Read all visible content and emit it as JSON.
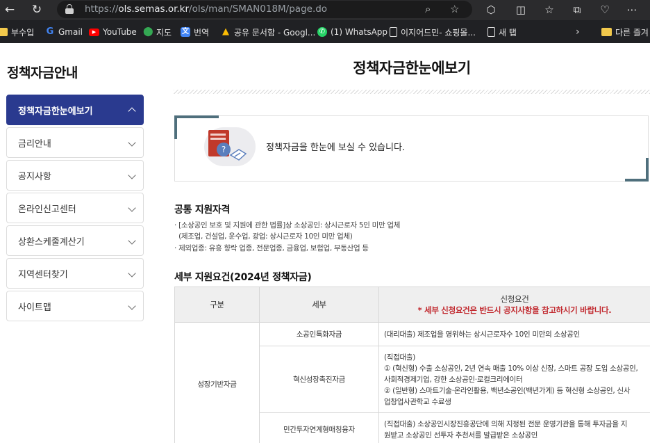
{
  "browser": {
    "url_prefix": "https://",
    "url_host": "ols.semas.or.kr",
    "url_path": "/ols/man/SMAN018M/page.do",
    "bookmarks": [
      {
        "label": "부수입",
        "icon": "folder-icon"
      },
      {
        "label": "Gmail",
        "icon": "google-icon"
      },
      {
        "label": "YouTube",
        "icon": "youtube-icon"
      },
      {
        "label": "지도",
        "icon": "maps-icon"
      },
      {
        "label": "번역",
        "icon": "translate-icon"
      },
      {
        "label": "공유 문서함 - Googl...",
        "icon": "drive-icon"
      },
      {
        "label": "(1) WhatsApp",
        "icon": "whatsapp-icon"
      },
      {
        "label": "이지어드민- 쇼핑몰...",
        "icon": "page-icon"
      },
      {
        "label": "새 탭",
        "icon": "page-icon"
      },
      {
        "label": "다른 즐겨",
        "icon": "folder-icon"
      }
    ]
  },
  "sidebar": {
    "title": "정책자금안내",
    "items": [
      {
        "label": "정책자금한눈에보기",
        "active": true
      },
      {
        "label": "금리안내"
      },
      {
        "label": "공지사항"
      },
      {
        "label": "온라인신고센터"
      },
      {
        "label": "상환스케줄계산기"
      },
      {
        "label": "지역센터찾기"
      },
      {
        "label": "사이트맵"
      }
    ]
  },
  "main": {
    "title": "정책자금한눈에보기",
    "intro": "정책자금을 한눈에 보실 수 있습니다.",
    "eligibility": {
      "title": "공통 지원자격",
      "lines": [
        "· [소상공인 보호 및 지원에 관한 법률]상 소상공인: 상시근로자 5인 미만 업체",
        "  (제조업, 건설업, 운수업, 광업: 상시근로자 10인 미만 업체)",
        "· 제외업종: 유흥 향락 업종, 전문업종, 금융업, 보험업, 부동산업 등"
      ]
    },
    "details": {
      "title": "세부 지원요건(2024년 정책자금)",
      "headers": {
        "category": "구분",
        "detail": "세부",
        "requirement": "신청요건",
        "notice": "* 세부 신청요건은 반드시 공지사항을 참고하시기 바랍니다."
      },
      "group": "성장기반자금",
      "rows": [
        {
          "detail": "소공인특화자금",
          "lines": [
            "(대리대출) 제조업을 영위하는 상시근로자수 10인 미만의 소상공인"
          ]
        },
        {
          "detail": "혁신성장촉진자금",
          "lines": [
            "(직접대출)",
            "① (혁신형) 수출 소상공인, 2년 연속 매출 10% 이상 신장, 스마트 공장 도입 소상공인,",
            "사회적경제기업, 강한 소상공인·로컬크리에이터",
            "② (일반형) 스마트기술·온라인활용, 백년소공인(백년가게) 등 혁신형 소상공인, 신사",
            "업창업사관학교 수료생"
          ]
        },
        {
          "detail": "민간투자연계형매칭융자",
          "lines": [
            "(직접대출) 소상공인시장진흥공단에 의해 지정된 전문 운영기관을 통해 투자금을 지",
            "원받고 소상공인 선투자 추천서를 발급받은 소상공인"
          ]
        }
      ]
    }
  }
}
